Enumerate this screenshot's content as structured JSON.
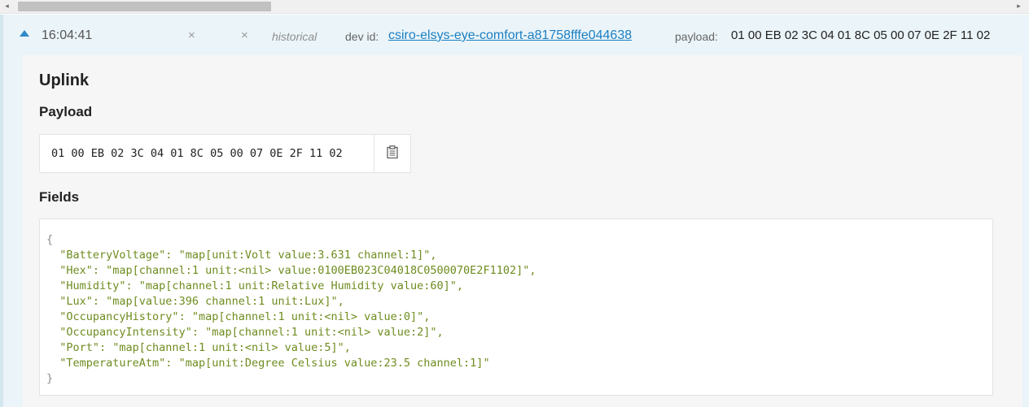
{
  "scrollbar": {
    "left_arrow": "◂",
    "right_arrow": "▸"
  },
  "event": {
    "time": "16:04:41",
    "x_mark_1": "×",
    "x_mark_2": "×",
    "historical": "historical",
    "dev_id_label": "dev id:",
    "dev_id": "csiro-elsys-eye-comfort-a81758fffe044638",
    "payload_label": "payload:",
    "payload_value": "01 00 EB 02 3C 04 01 8C 05 00 07 0E 2F 11 02",
    "expanded_icon": "caret-up-icon"
  },
  "detail": {
    "uplink_title": "Uplink",
    "payload_title": "Payload",
    "payload_hex": "01 00 EB 02 3C 04 01 8C 05 00 07 0E 2F 11 02",
    "copy_icon": "clipboard-icon",
    "fields_title": "Fields",
    "fields_open": "{",
    "fields_close": "}",
    "fields_lines": [
      "\"BatteryVoltage\": \"map[unit:Volt value:3.631 channel:1]\",",
      "\"Hex\": \"map[channel:1 unit:<nil> value:0100EB023C04018C0500070E2F1102]\",",
      "\"Humidity\": \"map[channel:1 unit:Relative Humidity value:60]\",",
      "\"Lux\": \"map[value:396 channel:1 unit:Lux]\",",
      "\"OccupancyHistory\": \"map[channel:1 unit:<nil> value:0]\",",
      "\"OccupancyIntensity\": \"map[channel:1 unit:<nil> value:2]\",",
      "\"Port\": \"map[channel:1 unit:<nil> value:5]\",",
      "\"TemperatureAtm\": \"map[unit:Degree Celsius value:23.5 channel:1]\""
    ]
  },
  "colors": {
    "accent": "#2f88c8",
    "link": "#1a7fc4",
    "json_string": "#6e8c1f",
    "row_bg": "#ebf4f8"
  }
}
